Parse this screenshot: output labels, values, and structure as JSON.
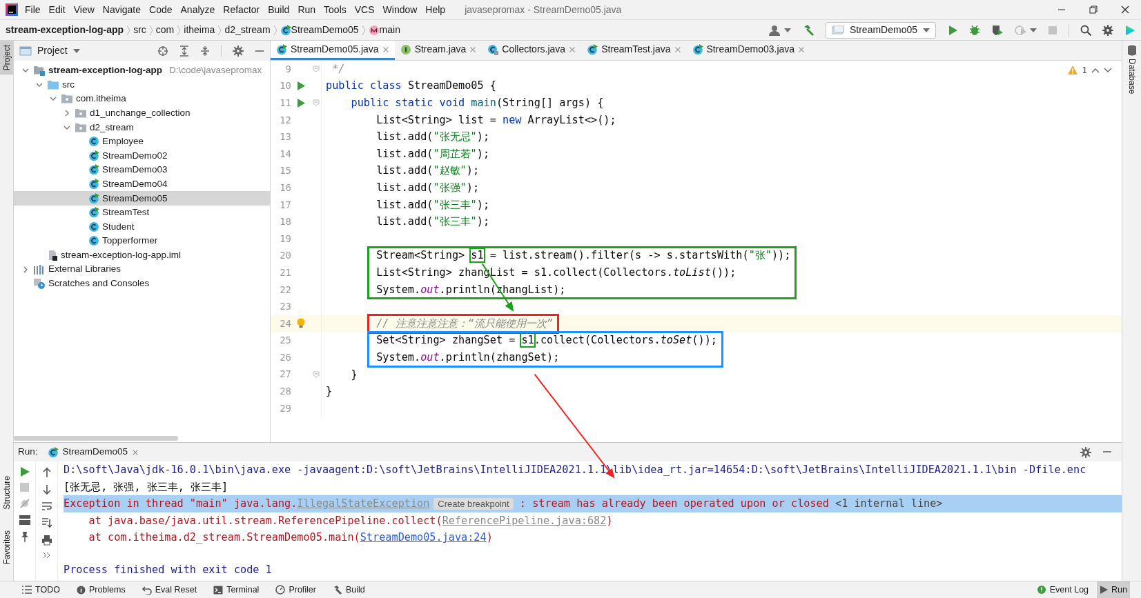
{
  "menu_bar": {
    "items": [
      "File",
      "Edit",
      "View",
      "Navigate",
      "Code",
      "Analyze",
      "Refactor",
      "Build",
      "Run",
      "Tools",
      "VCS",
      "Window",
      "Help"
    ],
    "title": "javasepromax - StreamDemo05.java"
  },
  "breadcrumbs": [
    {
      "label": "stream-exception-log-app",
      "kind": "project"
    },
    {
      "label": "src",
      "kind": "folder"
    },
    {
      "label": "com",
      "kind": "folder"
    },
    {
      "label": "itheima",
      "kind": "folder"
    },
    {
      "label": "d2_stream",
      "kind": "folder"
    },
    {
      "label": "StreamDemo05",
      "kind": "class"
    },
    {
      "label": "main",
      "kind": "method"
    }
  ],
  "toolbar": {
    "run_config": "StreamDemo05",
    "actions": [
      {
        "kind": "run",
        "disabled": false
      },
      {
        "kind": "debug",
        "disabled": false
      },
      {
        "kind": "coverage",
        "disabled": false
      },
      {
        "kind": "profile",
        "disabled": true
      },
      {
        "kind": "stop",
        "disabled": true
      }
    ]
  },
  "side_tabs": {
    "left_top": [
      {
        "label": "Project",
        "selected": true
      }
    ],
    "left_bottom": [
      {
        "label": "Structure",
        "selected": false
      },
      {
        "label": "Favorites",
        "selected": false
      }
    ],
    "right": [
      {
        "label": "Database",
        "selected": false
      }
    ]
  },
  "project_panel": {
    "title": "Project",
    "tree": [
      {
        "label": "stream-exception-log-app",
        "path": "D:\\code\\javasepromax",
        "kind": "module",
        "expanded": true,
        "selected": false,
        "children": [
          {
            "label": "src",
            "kind": "source-folder",
            "expanded": true,
            "selected": false,
            "children": [
              {
                "label": "com.itheima",
                "kind": "package",
                "expanded": true,
                "selected": false,
                "children": [
                  {
                    "label": "d1_unchange_collection",
                    "kind": "package",
                    "expanded": false,
                    "selected": false
                  },
                  {
                    "label": "d2_stream",
                    "kind": "package",
                    "expanded": true,
                    "selected": false,
                    "children": [
                      {
                        "label": "Employee",
                        "kind": "class",
                        "selected": false
                      },
                      {
                        "label": "StreamDemo02",
                        "kind": "runnable-class",
                        "selected": false
                      },
                      {
                        "label": "StreamDemo03",
                        "kind": "runnable-class",
                        "selected": false
                      },
                      {
                        "label": "StreamDemo04",
                        "kind": "runnable-class",
                        "selected": false
                      },
                      {
                        "label": "StreamDemo05",
                        "kind": "runnable-class",
                        "selected": true
                      },
                      {
                        "label": "StreamTest",
                        "kind": "runnable-class",
                        "selected": false
                      },
                      {
                        "label": "Student",
                        "kind": "class",
                        "selected": false
                      },
                      {
                        "label": "Topperformer",
                        "kind": "class",
                        "selected": false
                      }
                    ]
                  }
                ]
              }
            ]
          },
          {
            "label": "stream-exception-log-app.iml",
            "kind": "iml-file",
            "selected": false
          }
        ]
      },
      {
        "label": "External Libraries",
        "kind": "libraries",
        "expanded": false,
        "selected": false
      },
      {
        "label": "Scratches and Consoles",
        "kind": "scratches",
        "selected": false
      }
    ]
  },
  "editor": {
    "tabs": [
      {
        "label": "StreamDemo05.java",
        "kind": "runnable-class",
        "selected": true
      },
      {
        "label": "Stream.java",
        "kind": "interface",
        "selected": false
      },
      {
        "label": "Collectors.java",
        "kind": "library-class",
        "selected": false
      },
      {
        "label": "StreamTest.java",
        "kind": "runnable-class",
        "selected": false
      },
      {
        "label": "StreamDemo03.java",
        "kind": "runnable-class",
        "selected": false
      }
    ],
    "warnings": "1",
    "lines": [
      {
        "number": "9",
        "runnable": false,
        "foldable": true,
        "has_hint": false,
        "current": false,
        "tokens": [
          {
            "text": " */",
            "kind": "comment"
          }
        ]
      },
      {
        "number": "10",
        "runnable": true,
        "foldable": false,
        "has_hint": false,
        "current": false,
        "tokens": [
          {
            "text": "public class",
            "kind": "keyword"
          },
          {
            "text": " StreamDemo05 {",
            "kind": "plain"
          }
        ]
      },
      {
        "number": "11",
        "runnable": true,
        "foldable": true,
        "has_hint": false,
        "current": false,
        "tokens": [
          {
            "text": "    public static void",
            "kind": "keyword"
          },
          {
            "text": " main",
            "kind": "declaration"
          },
          {
            "text": "(String[] args) {",
            "kind": "plain"
          }
        ]
      },
      {
        "number": "12",
        "current": false,
        "tokens": [
          {
            "text": "        List<String> list = ",
            "kind": "plain"
          },
          {
            "text": "new",
            "kind": "keyword"
          },
          {
            "text": " ArrayList<>();",
            "kind": "plain"
          }
        ]
      },
      {
        "number": "13",
        "current": false,
        "tokens": [
          {
            "text": "        list.add(",
            "kind": "plain"
          },
          {
            "text": "\"张无忌\"",
            "kind": "string"
          },
          {
            "text": ");",
            "kind": "plain"
          }
        ]
      },
      {
        "number": "14",
        "current": false,
        "tokens": [
          {
            "text": "        list.add(",
            "kind": "plain"
          },
          {
            "text": "\"周芷若\"",
            "kind": "string"
          },
          {
            "text": ");",
            "kind": "plain"
          }
        ]
      },
      {
        "number": "15",
        "current": false,
        "tokens": [
          {
            "text": "        list.add(",
            "kind": "plain"
          },
          {
            "text": "\"赵敏\"",
            "kind": "string"
          },
          {
            "text": ");",
            "kind": "plain"
          }
        ]
      },
      {
        "number": "16",
        "current": false,
        "tokens": [
          {
            "text": "        list.add(",
            "kind": "plain"
          },
          {
            "text": "\"张强\"",
            "kind": "string"
          },
          {
            "text": ");",
            "kind": "plain"
          }
        ]
      },
      {
        "number": "17",
        "current": false,
        "tokens": [
          {
            "text": "        list.add(",
            "kind": "plain"
          },
          {
            "text": "\"张三丰\"",
            "kind": "string"
          },
          {
            "text": ");",
            "kind": "plain"
          }
        ]
      },
      {
        "number": "18",
        "current": false,
        "tokens": [
          {
            "text": "        list.add(",
            "kind": "plain"
          },
          {
            "text": "\"张三丰\"",
            "kind": "string"
          },
          {
            "text": ");",
            "kind": "plain"
          }
        ]
      },
      {
        "number": "19",
        "current": false
      },
      {
        "number": "20",
        "current": false,
        "color": "#1aa31a",
        "tokens": [
          {
            "text": "        Stream<String> ",
            "kind": "plain"
          },
          {
            "text": "s1",
            "kind": "boxed"
          },
          {
            "text": " = list.stream().filter(s -> s.startsWith(",
            "kind": "plain"
          },
          {
            "text": "\"张\"",
            "kind": "string"
          },
          {
            "text": "));",
            "kind": "plain"
          }
        ]
      },
      {
        "number": "21",
        "current": false,
        "color": "#1aa31a",
        "tokens": [
          {
            "text": "        List<String> zhangList = s1.collect(Collectors.",
            "kind": "plain"
          },
          {
            "text": "toList",
            "kind": "static"
          },
          {
            "text": "());",
            "kind": "plain"
          }
        ]
      },
      {
        "number": "22",
        "current": false,
        "color": "#1aa31a",
        "tokens": [
          {
            "text": "        System.",
            "kind": "plain"
          },
          {
            "text": "out",
            "kind": "field"
          },
          {
            "text": ".println(zhangList);",
            "kind": "plain"
          }
        ]
      },
      {
        "number": "23",
        "current": false
      },
      {
        "number": "24",
        "runnable": false,
        "foldable": false,
        "has_hint": true,
        "current": true,
        "color": "#e82424",
        "tokens": [
          {
            "text": "        // 注意注意注意：“流只能使用一次”",
            "kind": "comment"
          }
        ]
      },
      {
        "number": "25",
        "current": false,
        "color": "#1e8fff",
        "tokens": [
          {
            "text": "        Set<String> zhangSet = ",
            "kind": "plain"
          },
          {
            "text": "s1",
            "kind": "boxed"
          },
          {
            "text": ".collect(Collectors.",
            "kind": "plain"
          },
          {
            "text": "toSet",
            "kind": "static"
          },
          {
            "text": "());",
            "kind": "plain"
          }
        ]
      },
      {
        "number": "26",
        "current": false,
        "color": "#1e8fff",
        "tokens": [
          {
            "text": "        System.",
            "kind": "plain"
          },
          {
            "text": "out",
            "kind": "field"
          },
          {
            "text": ".println(zhangSet);",
            "kind": "plain"
          }
        ]
      },
      {
        "number": "27",
        "runnable": false,
        "foldable": true,
        "has_hint": false,
        "current": false,
        "tokens": [
          {
            "text": "    }",
            "kind": "plain"
          }
        ]
      },
      {
        "number": "28",
        "current": false,
        "tokens": [
          {
            "text": "}",
            "kind": "plain"
          }
        ]
      },
      {
        "number": "29",
        "current": false
      }
    ]
  },
  "run_panel": {
    "label": "Run:",
    "tab": "StreamDemo05",
    "console": [
      {
        "kind": "command",
        "selected": false,
        "segments": [
          {
            "text": "D:\\soft\\Java\\jdk-16.0.1\\bin\\java.exe -javaagent:D:\\soft\\JetBrains\\IntelliJIDEA2021.1.1\\lib\\idea_rt.jar=14654:D:\\soft\\JetBrains\\IntelliJIDEA2021.1.1\\bin -Dfile.enc",
            "kind": "text"
          }
        ]
      },
      {
        "kind": "output",
        "selected": false,
        "segments": [
          {
            "text": "[张无忌, 张强, 张三丰, 张三丰]",
            "kind": "text"
          }
        ]
      },
      {
        "kind": "error",
        "selected": true,
        "segments": [
          {
            "text": "Exception in thread \"main\" java.lang.",
            "kind": "text"
          },
          {
            "text": "IllegalStateException",
            "kind": "library-link"
          },
          {
            "text": "Create breakpoint",
            "kind": "hint"
          },
          {
            "text": " : stream has already been operated upon or closed ",
            "kind": "text"
          },
          {
            "text": "<1 internal line>",
            "kind": "folded"
          }
        ]
      },
      {
        "kind": "error",
        "selected": false,
        "segments": [
          {
            "text": "    at java.base/java.util.stream.ReferencePipeline.collect(",
            "kind": "text"
          },
          {
            "text": "ReferencePipeline.java:682",
            "kind": "library-link"
          },
          {
            "text": ")",
            "kind": "text"
          }
        ]
      },
      {
        "kind": "error",
        "selected": false,
        "segments": [
          {
            "text": "    at com.itheima.d2_stream.StreamDemo05.main(",
            "kind": "text"
          },
          {
            "text": "StreamDemo05.java:24",
            "kind": "link"
          },
          {
            "text": ")",
            "kind": "text"
          }
        ]
      },
      {
        "kind": "system",
        "selected": false,
        "segments": [
          {
            "text": "Process finished with exit code 1",
            "kind": "text"
          }
        ]
      }
    ]
  },
  "bottom_bar": {
    "tools": [
      {
        "label": "TODO",
        "kind": "todo",
        "selected": false
      },
      {
        "label": "Problems",
        "kind": "problems",
        "selected": false
      },
      {
        "label": "Eval Reset",
        "kind": "reset",
        "selected": false
      },
      {
        "label": "Terminal",
        "kind": "terminal",
        "selected": false
      },
      {
        "label": "Profiler",
        "kind": "profiler",
        "selected": false
      },
      {
        "label": "Build",
        "kind": "build",
        "selected": false
      }
    ],
    "right_tools": [
      {
        "label": "Event Log",
        "kind": "event-log",
        "selected": false
      },
      {
        "label": "Run",
        "kind": "run",
        "selected": true
      }
    ]
  }
}
